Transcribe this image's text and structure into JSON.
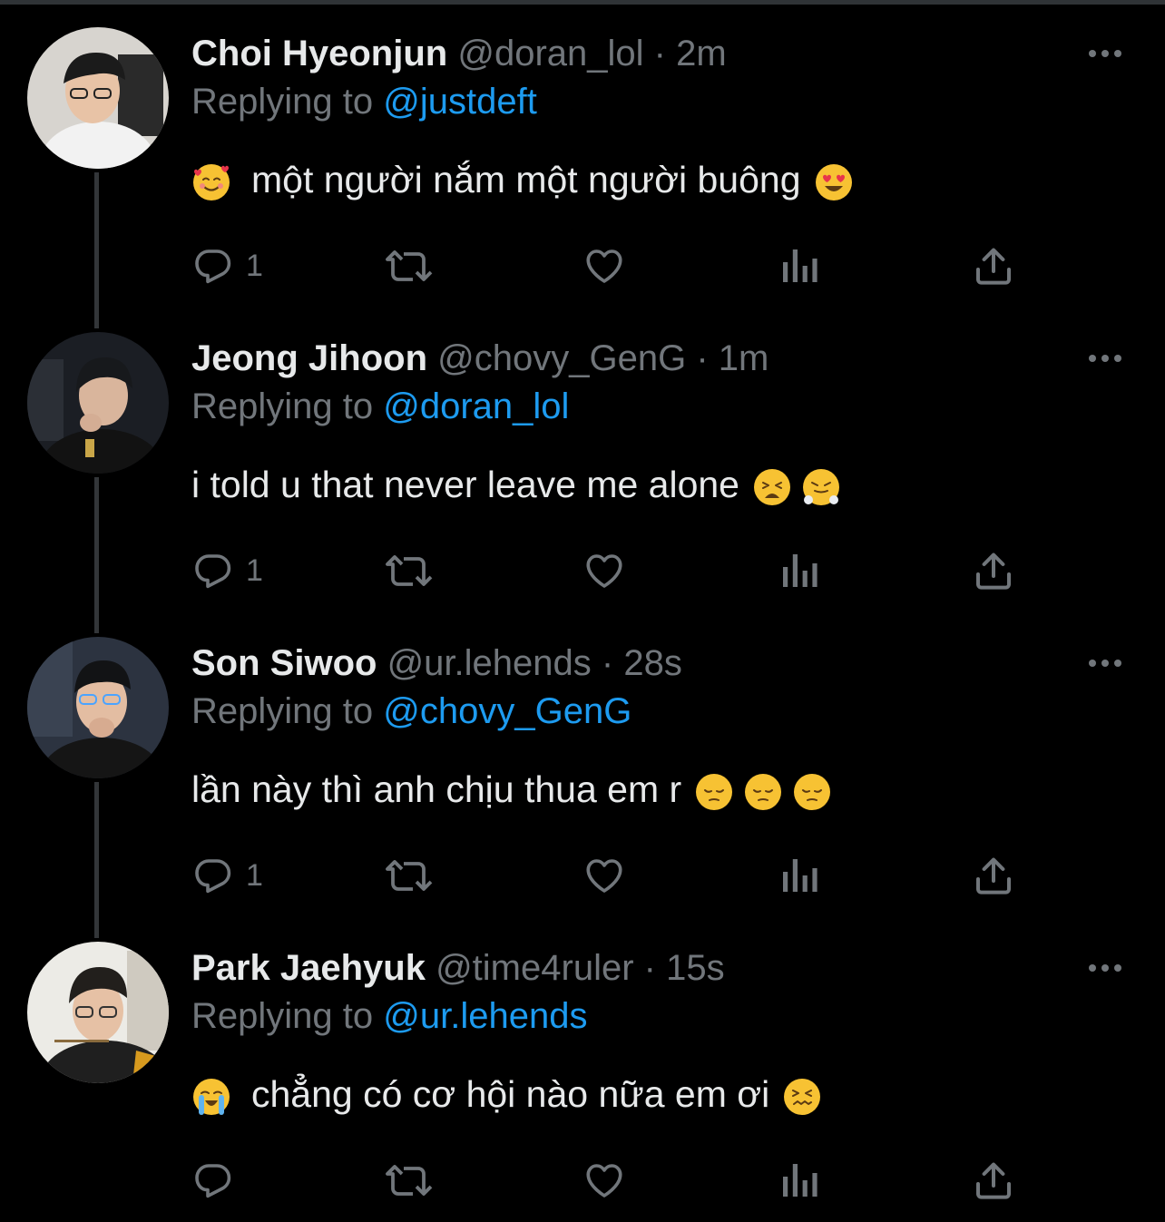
{
  "colors": {
    "background": "#000000",
    "primary_text": "#e7e9ea",
    "secondary_text": "#71767b",
    "link": "#1d9bf0",
    "thread_line": "#333639"
  },
  "tweets": [
    {
      "name": "Choi Hyeonjun",
      "handle": "@doran_lol",
      "separator": "·",
      "time": "2m",
      "replying_prefix": "Replying to",
      "replying_to": "@justdeft",
      "lead_emoji": "smiling-face-with-hearts",
      "text": "một người nắm một người buông",
      "trail_emojis": [
        "heart-eyes"
      ],
      "reply_count": "1"
    },
    {
      "name": "Jeong Jihoon",
      "handle": "@chovy_GenG",
      "separator": "·",
      "time": "1m",
      "replying_prefix": "Replying to",
      "replying_to": "@doran_lol",
      "lead_emoji": null,
      "text": "i told u that never leave me alone",
      "trail_emojis": [
        "weary-face",
        "face-with-steam"
      ],
      "reply_count": "1"
    },
    {
      "name": "Son Siwoo",
      "handle": "@ur.lehends",
      "separator": "·",
      "time": "28s",
      "replying_prefix": "Replying to",
      "replying_to": "@chovy_GenG",
      "lead_emoji": null,
      "text": "lần này thì anh chịu thua em r",
      "trail_emojis": [
        "pensive-face",
        "pensive-face",
        "pensive-face"
      ],
      "reply_count": "1"
    },
    {
      "name": "Park Jaehyuk",
      "handle": "@time4ruler",
      "separator": "·",
      "time": "15s",
      "replying_prefix": "Replying to",
      "replying_to": "@ur.lehends",
      "lead_emoji": "loudly-crying-face",
      "text": "chẳng có cơ hội nào nữa em ơi",
      "trail_emojis": [
        "confounded-face"
      ],
      "reply_count": ""
    }
  ]
}
